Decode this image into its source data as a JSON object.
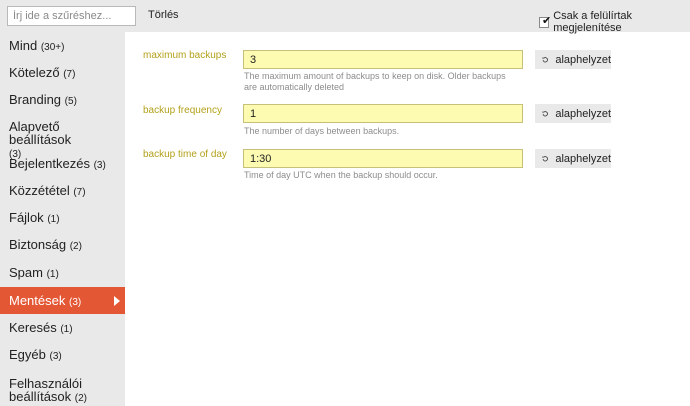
{
  "topbar": {
    "filter_placeholder": "Írj ide a szűréshez...",
    "clear_label": "Törlés",
    "only_overridden_label": "Csak a felülírtak megjelenítése",
    "only_overridden_checked": true
  },
  "sidebar": {
    "items": [
      {
        "label": "Mind",
        "count": "(30+)"
      },
      {
        "label": "Kötelező",
        "count": "(7)"
      },
      {
        "label": "Branding",
        "count": "(5)"
      },
      {
        "label": "Alapvető beállítások",
        "count": "(3)"
      },
      {
        "label": "Bejelentkezés",
        "count": "(3)"
      },
      {
        "label": "Közzététel",
        "count": "(7)"
      },
      {
        "label": "Fájlok",
        "count": "(1)"
      },
      {
        "label": "Biztonság",
        "count": "(2)"
      },
      {
        "label": "Spam",
        "count": "(1)"
      },
      {
        "label": "Mentések",
        "count": "(3)"
      },
      {
        "label": "Keresés",
        "count": "(1)"
      },
      {
        "label": "Egyéb",
        "count": "(3)"
      },
      {
        "label": "Felhasználói beállítások",
        "count": "(2)"
      }
    ],
    "active_index": 9
  },
  "settings": [
    {
      "name": "maximum backups",
      "value": "3",
      "description": "The maximum amount of backups to keep on disk. Older backups are automatically deleted",
      "reset_label": "alaphelyzet"
    },
    {
      "name": "backup frequency",
      "value": "1",
      "description": "The number of days between backups.",
      "reset_label": "alaphelyzet"
    },
    {
      "name": "backup time of day",
      "value": "1:30",
      "description": "Time of day UTC when the backup should occur.",
      "reset_label": "alaphelyzet"
    }
  ],
  "colors": {
    "accent": "#e45735",
    "label_color": "#b3a11b",
    "input_bg": "#fdfbb2",
    "panel_bg": "#e9e9e9"
  },
  "icons": {
    "reset": "undo-arrow-icon",
    "active_indicator": "triangle-right-icon",
    "checkbox": "checkmark-icon"
  }
}
